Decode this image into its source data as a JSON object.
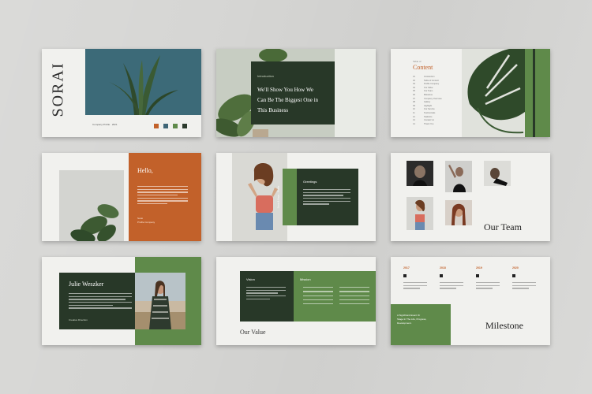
{
  "watermark": "",
  "slides": {
    "cover": {
      "brand": "SORAI",
      "caption": "Company Profile · 2021",
      "swatches": [
        "#c2612a",
        "#3f6576",
        "#5f8a4a",
        "#2b3a2c"
      ]
    },
    "intro": {
      "label": "Introduction",
      "heading_line1": "We'll Show You How We",
      "heading_line2": "Can Be The Biggest One in",
      "heading_line3": "This Business"
    },
    "content": {
      "label": "Table of",
      "title": "Content",
      "items": [
        "Introduction",
        "Table of Content",
        "Profile Company",
        "Our Value",
        "Our Team",
        "Milestone",
        "Company Overview",
        "Gallery",
        "Highlight",
        "Our Service",
        "Testimonials",
        "Statistics",
        "Contact Us",
        "Thank You"
      ]
    },
    "hello": {
      "title": "Hello,",
      "signoff_line1": "Sorai",
      "signoff_line2": "Profile Company"
    },
    "greetings": {
      "label": "Greetings",
      "vertical_text": "Sorai & Kaya · Profile"
    },
    "team": {
      "title": "Our Team"
    },
    "julie": {
      "name": "Julie Weszker",
      "role": "Creative Direction"
    },
    "value": {
      "title": "Our Value",
      "vision": "Vision",
      "mission": "Mission"
    },
    "milestone": {
      "title": "Milestone",
      "years": [
        "2017",
        "2018",
        "2019",
        "2020"
      ],
      "box_text_line1": "A Significant Event Or",
      "box_text_line2": "Stage In The Life, Progress,",
      "box_text_line3": "Development."
    }
  },
  "colors": {
    "orange": "#c2612a",
    "green": "#5f8a4a",
    "dark_green": "#283828",
    "teal": "#3c6a78",
    "paper": "#f1f1ee"
  }
}
